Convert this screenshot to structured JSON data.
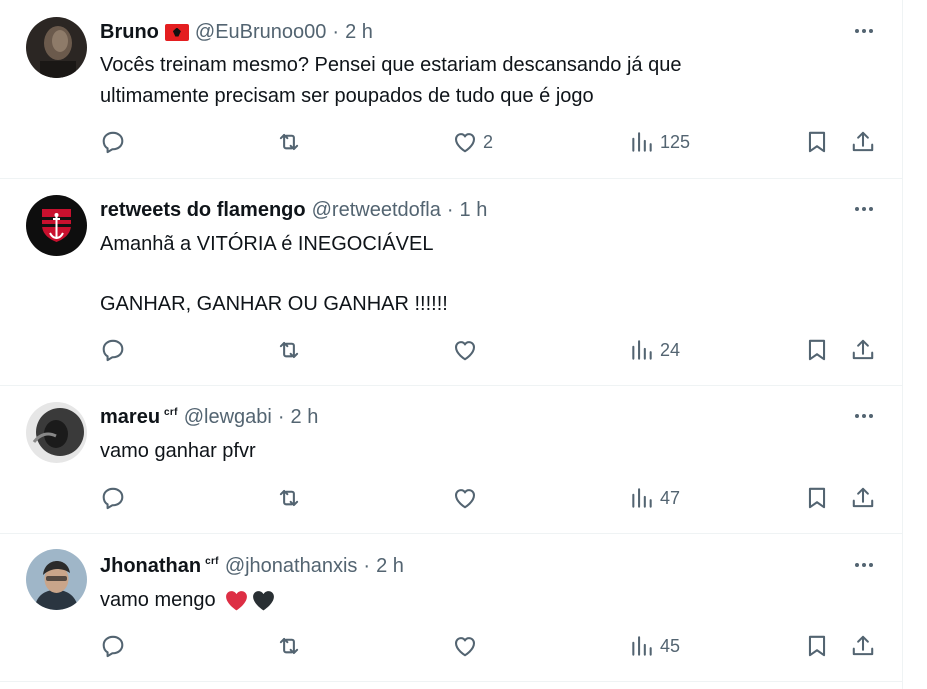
{
  "tweets": [
    {
      "name": "Bruno",
      "handle": "@EuBrunoo00",
      "dot": "·",
      "time": "2 h",
      "text": "Vocês treinam mesmo? Pensei que estariam descansando já que\nultimamente precisam ser poupados de tudo que é jogo",
      "likes": "2",
      "views": "125"
    },
    {
      "name": "retweets do flamengo",
      "handle": "@retweetdofla",
      "dot": "·",
      "time": "1 h",
      "text": "Amanhã a VITÓRIA é INEGOCIÁVEL\n\nGANHAR, GANHAR OU GANHAR !!!!!!",
      "likes": "",
      "views": "24"
    },
    {
      "name": "mareu",
      "badge": "crf",
      "handle": "@lewgabi",
      "dot": "·",
      "time": "2 h",
      "text": "vamo ganhar pfvr",
      "likes": "",
      "views": "47"
    },
    {
      "name": "Jhonathan",
      "badge": "crf",
      "handle": "@jhonathanxis",
      "dot": "·",
      "time": "2 h",
      "text": "vamo mengo",
      "likes": "",
      "views": "45"
    }
  ],
  "icons": {
    "reply": "reply-icon",
    "retweet": "retweet-icon",
    "like": "heart-icon",
    "views": "views-icon",
    "bookmark": "bookmark-icon",
    "share": "share-icon",
    "more": "more-icon"
  },
  "colors": {
    "text": "#0f1419",
    "secondary": "#536471",
    "divider": "#eff3f4",
    "flag_red": "#e41e20",
    "heart_red": "#e0245e"
  }
}
